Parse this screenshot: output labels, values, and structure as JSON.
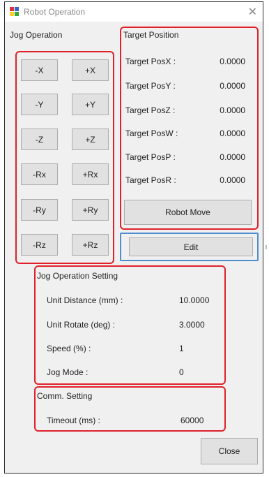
{
  "window": {
    "title": "Robot Operation"
  },
  "jog": {
    "title": "Jog Operation",
    "buttons": [
      "-X",
      "+X",
      "-Y",
      "+Y",
      "-Z",
      "+Z",
      "-Rx",
      "+Rx",
      "-Ry",
      "+Ry",
      "-Rz",
      "+Rz"
    ]
  },
  "target": {
    "title": "Target Position",
    "rows": [
      {
        "label": "Target PosX :",
        "value": "0.0000"
      },
      {
        "label": "Target PosY :",
        "value": "0.0000"
      },
      {
        "label": "Target PosZ :",
        "value": "0.0000"
      },
      {
        "label": "Target PosW :",
        "value": "0.0000"
      },
      {
        "label": "Target PosP :",
        "value": "0.0000"
      },
      {
        "label": "Target PosR :",
        "value": "0.0000"
      }
    ],
    "move_label": "Robot Move"
  },
  "edit_label": "Edit",
  "jog_setting": {
    "title": "Jog Operation Setting",
    "rows": [
      {
        "label": "Unit Distance (mm) :",
        "value": "10.0000"
      },
      {
        "label": "Unit Rotate (deg) :",
        "value": "3.0000"
      },
      {
        "label": "Speed (%) :",
        "value": "1"
      },
      {
        "label": "Jog Mode :",
        "value": "0"
      }
    ]
  },
  "comm": {
    "title": "Comm. Setting",
    "timeout_label": "Timeout (ms) :",
    "timeout_value": "60000"
  },
  "close_label": "Close",
  "colors": {
    "highlight_red": "#e0202a",
    "highlight_blue": "#4f8fd0"
  }
}
